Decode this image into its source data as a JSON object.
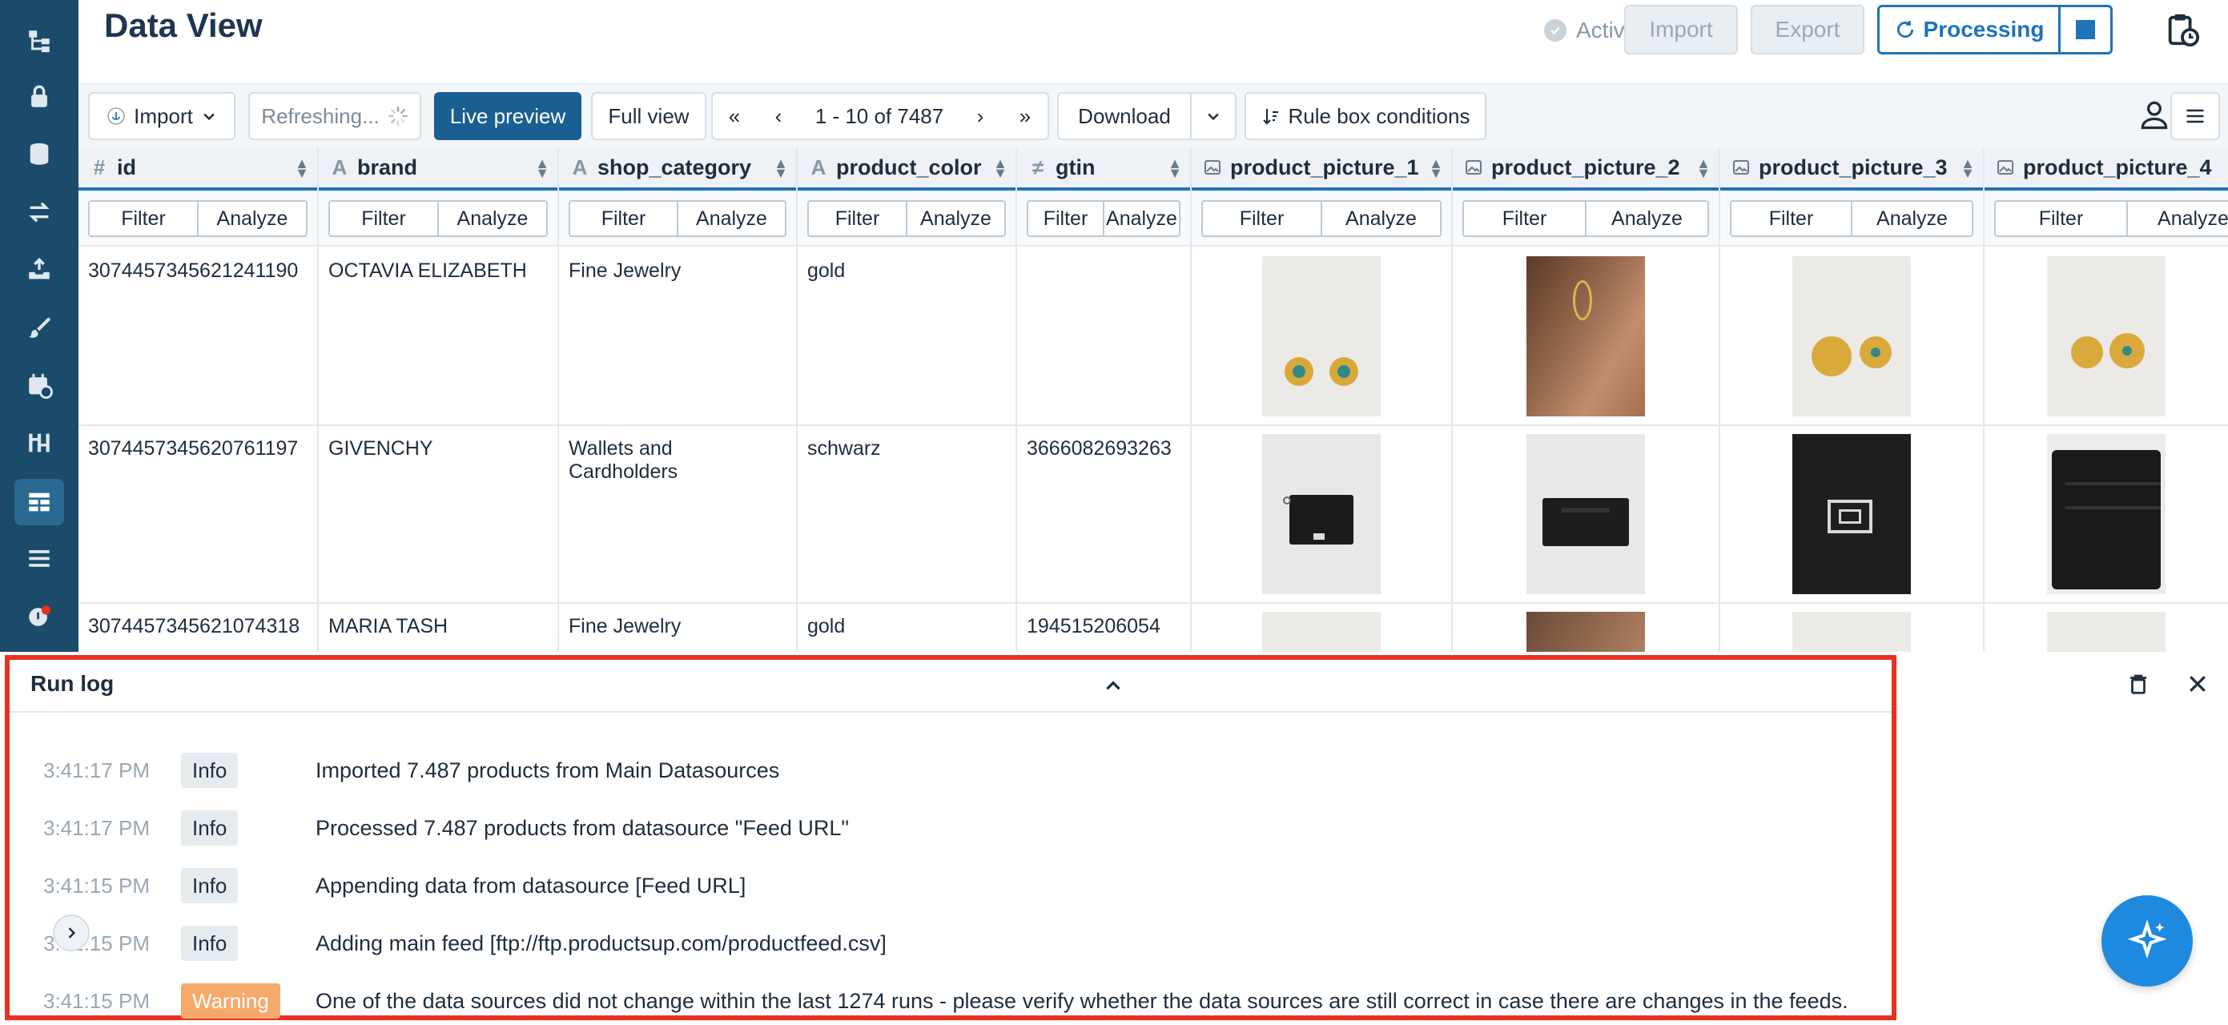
{
  "header": {
    "title": "Data View",
    "status": "Active",
    "import_label": "Import",
    "export_label": "Export",
    "processing_label": "Processing"
  },
  "toolbar": {
    "import_label": "Import",
    "refreshing_label": "Refreshing...",
    "live_preview_label": "Live preview",
    "full_view_label": "Full view",
    "first_page": "«",
    "prev_page": "‹",
    "range": "1 - 10 of 7487",
    "next_page": "›",
    "last_page": "»",
    "download_label": "Download",
    "rule_box_label": "Rule box conditions"
  },
  "table": {
    "filter_label": "Filter",
    "analyze_label": "Analyze",
    "columns": [
      {
        "name": "id",
        "type_icon": "#"
      },
      {
        "name": "brand",
        "type_icon": "A"
      },
      {
        "name": "shop_category",
        "type_icon": "A"
      },
      {
        "name": "product_color",
        "type_icon": "A"
      },
      {
        "name": "gtin",
        "type_icon": "≠"
      },
      {
        "name": "product_picture_1",
        "type_icon": "image"
      },
      {
        "name": "product_picture_2",
        "type_icon": "image"
      },
      {
        "name": "product_picture_3",
        "type_icon": "image"
      },
      {
        "name": "product_picture_4",
        "type_icon": "image"
      }
    ],
    "rows": [
      {
        "id": "3074457345621241190",
        "brand": "OCTAVIA ELIZABETH",
        "shop_category": "Fine Jewelry",
        "product_color": "gold",
        "gtin": ""
      },
      {
        "id": "3074457345620761197",
        "brand": "GIVENCHY",
        "shop_category": "Wallets and Cardholders",
        "product_color": "schwarz",
        "gtin": "3666082693263"
      },
      {
        "id": "3074457345621074318",
        "brand": "MARIA TASH",
        "shop_category": "Fine Jewelry",
        "product_color": "gold",
        "gtin": "194515206054"
      }
    ]
  },
  "runlog": {
    "title": "Run log",
    "entries": [
      {
        "time": "3:41:17 PM",
        "level": "Info",
        "message": "Imported 7.487 products from Main Datasources"
      },
      {
        "time": "3:41:17 PM",
        "level": "Info",
        "message": "Processed 7.487 products from datasource \"Feed URL\""
      },
      {
        "time": "3:41:15 PM",
        "level": "Info",
        "message": "Appending data from datasource [Feed URL]"
      },
      {
        "time": "3:41:15 PM",
        "level": "Info",
        "message": "Adding main feed [ftp://ftp.productsup.com/productfeed.csv]"
      },
      {
        "time": "3:41:15 PM",
        "level": "Warning",
        "message": "One of the data sources did not change within the last 1274 runs - please verify whether the data sources are still correct in case there are changes in the feeds."
      }
    ]
  },
  "colors": {
    "sidebar": "#1b4b6b",
    "accent": "#1d74b9",
    "primary_button": "#1a5f92",
    "warning": "#f5a96a",
    "highlight_frame": "#e8321f"
  }
}
